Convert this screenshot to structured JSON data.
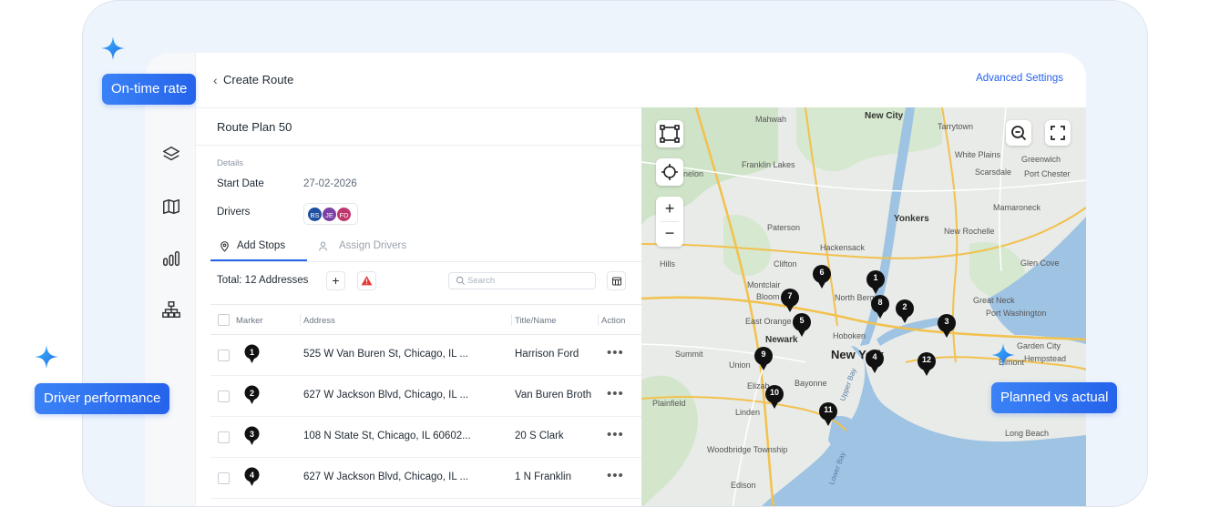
{
  "badges": {
    "on_time": "On-time rate",
    "driver_perf": "Driver performance",
    "planned_actual": "Planned vs actual"
  },
  "header": {
    "back_symbol": "‹",
    "title": "Create Route",
    "advanced_settings": "Advanced Settings"
  },
  "sidebar": {
    "items": [
      {
        "icon": "layers-icon"
      },
      {
        "icon": "map-icon"
      },
      {
        "icon": "bar-chart-icon"
      },
      {
        "icon": "org-chart-icon"
      }
    ]
  },
  "route": {
    "plan_name": "Route Plan 50",
    "details_heading": "Details",
    "start_date_label": "Start Date",
    "start_date": "27-02-2026",
    "drivers_label": "Drivers",
    "drivers": [
      {
        "initials": "BS",
        "color": "#1e4fa0"
      },
      {
        "initials": "JE",
        "color": "#7b3fa6"
      },
      {
        "initials": "FD",
        "color": "#c0356b"
      }
    ]
  },
  "tabs": [
    {
      "label": "Add Stops",
      "active": true
    },
    {
      "label": "Assign Drivers",
      "active": false
    }
  ],
  "toolbar": {
    "total": "Total: 12 Addresses",
    "add_symbol": "+",
    "search_placeholder": "Search"
  },
  "table": {
    "columns": [
      "Marker",
      "Address",
      "Title/Name",
      "Action"
    ],
    "rows": [
      {
        "marker": "1",
        "address": "525 W Van Buren St, Chicago, IL ...",
        "title": "Harrison Ford",
        "action": "•••"
      },
      {
        "marker": "2",
        "address": "627 W Jackson Blvd, Chicago, IL ...",
        "title": "Van Buren Broth",
        "action": "•••"
      },
      {
        "marker": "3",
        "address": "108 N State St, Chicago, IL 60602...",
        "title": "20 S Clark",
        "action": "•••"
      },
      {
        "marker": "4",
        "address": "627 W Jackson Blvd, Chicago, IL ...",
        "title": "1 N Franklin",
        "action": "•••"
      }
    ]
  },
  "map": {
    "zoom_in": "+",
    "zoom_out": "−",
    "labels": {
      "mahwah": "Mahwah",
      "tarrytown": "Tarrytown",
      "new_city": "New City",
      "greenwich": "Greenwich",
      "white_plains": "White Plains",
      "franklin_lakes": "Franklin Lakes",
      "scarsdale": "Scarsdale",
      "port_chester": "Port Chester",
      "denville": "nelon",
      "mamaroneck": "Mamaroneck",
      "yonkers": "Yonkers",
      "paterson": "Paterson",
      "new_rochelle": "New Rochelle",
      "hackensack": "Hackensack",
      "clifton": "Clifton",
      "glen_cove": "Glen Cove",
      "montclair": "Montclair",
      "bloomfield": "Bloom",
      "north_bergen": "North Berg",
      "great_neck": "Great Neck",
      "port_washington": "Port Washington",
      "east_orange": "East Orange",
      "hoboken": "Hoboken",
      "newark": "Newark",
      "new_york": "New York",
      "summit": "Summit",
      "union": "Union",
      "garden_city": "Garden City",
      "hempstead": "Hempstead",
      "elizabeth": "Elizab",
      "bayonne": "Bayonne",
      "elmont": "Elmont",
      "plainfield": "Plainfield",
      "linden": "Linden",
      "woodbridge": "Woodbridge Township",
      "edison": "Edison",
      "long_beach": "Long Beach",
      "hills": "Hills",
      "upper_bay": "Upper Bay",
      "lower_bay": "Lower Bay"
    },
    "markers": [
      "1",
      "2",
      "3",
      "4",
      "5",
      "6",
      "7",
      "8",
      "9",
      "10",
      "11",
      "12"
    ]
  }
}
